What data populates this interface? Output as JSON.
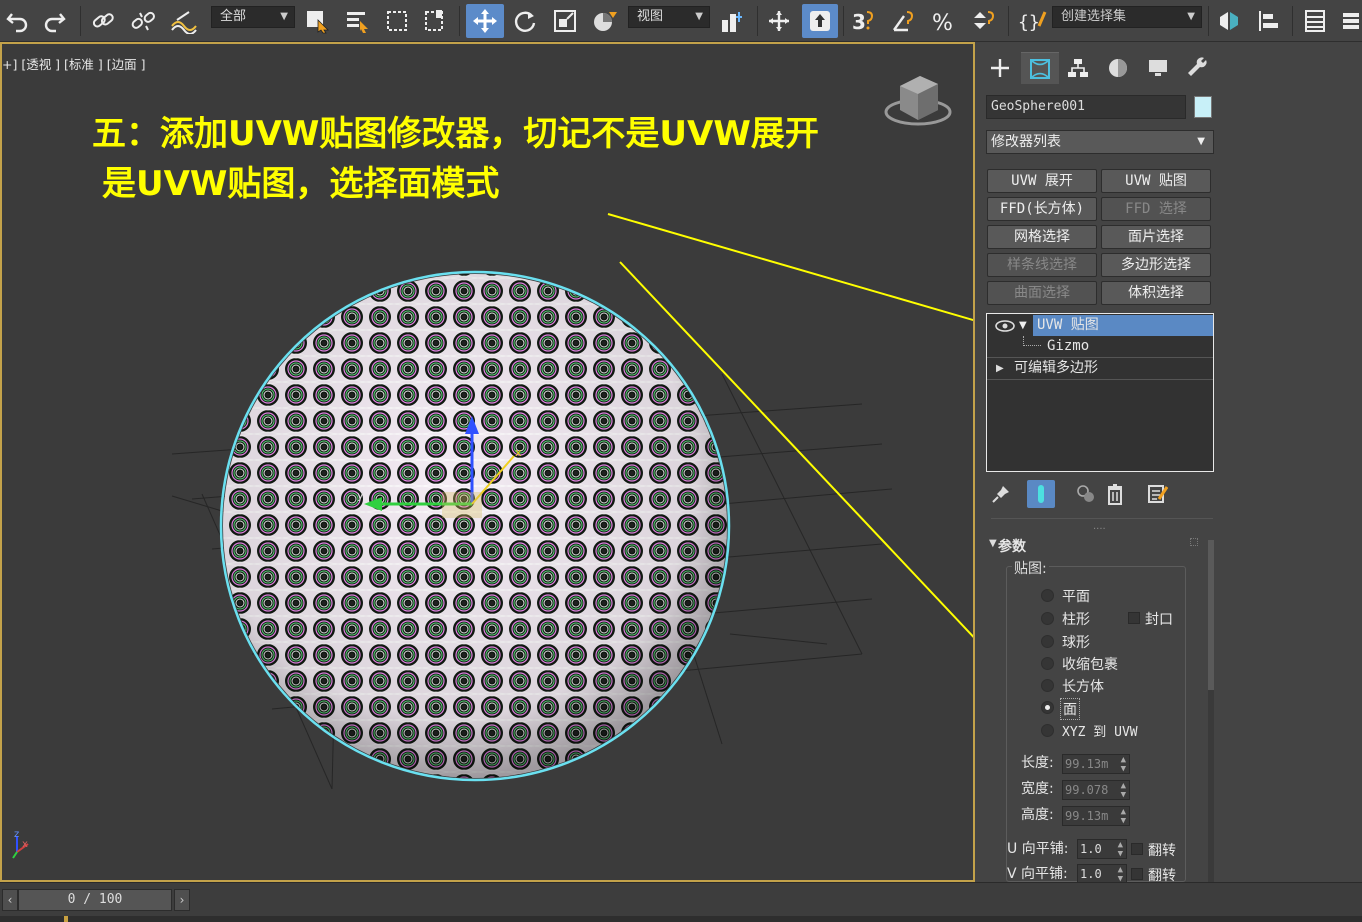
{
  "toolbar": {
    "selection_filter": "全部",
    "ref_coord": "视图",
    "named_selection_placeholder": "创建选择集"
  },
  "viewport": {
    "label": "+] [透视 ] [标准 ] [边面 ]",
    "annotation_line1": "五：添加UVW贴图修改器，切记不是UVW展开",
    "annotation_line2": "是UVW贴图，选择面模式",
    "gizmo_x": "x",
    "gizmo_y": "y",
    "axis_z": "z",
    "axis_x": "x",
    "annotation_color": "#ffff00"
  },
  "panel": {
    "object_name": "GeoSphere001",
    "object_color": "#c8f0f8",
    "modifier_list": "修改器列表",
    "modifier_buttons": [
      {
        "label": "UVW 展开",
        "enabled": true
      },
      {
        "label": "UVW 贴图",
        "enabled": true
      },
      {
        "label": "FFD(长方体)",
        "enabled": true
      },
      {
        "label": "FFD 选择",
        "enabled": false
      },
      {
        "label": "网格选择",
        "enabled": true
      },
      {
        "label": "面片选择",
        "enabled": true
      },
      {
        "label": "样条线选择",
        "enabled": false
      },
      {
        "label": "多边形选择",
        "enabled": true
      },
      {
        "label": "曲面选择",
        "enabled": false
      },
      {
        "label": "体积选择",
        "enabled": true
      }
    ],
    "stack": [
      {
        "label": "UVW 贴图",
        "selected": true
      },
      {
        "label": "Gizmo",
        "selected": false
      },
      {
        "label": "可编辑多边形",
        "selected": false
      }
    ],
    "rollout_title": "参数",
    "mapping_group": "贴图:",
    "mapping_options": [
      "平面",
      "柱形",
      "球形",
      "收缩包裹",
      "长方体",
      "面",
      "XYZ 到 UVW"
    ],
    "mapping_selected": "面",
    "cap_label": "封口",
    "length_label": "长度:",
    "length_value": "99.13m",
    "width_label": "宽度:",
    "width_value": "99.078",
    "height_label": "高度:",
    "height_value": "99.13m",
    "u_tile_label": "U 向平铺:",
    "u_tile_value": "1.0",
    "v_tile_label": "V 向平铺:",
    "v_tile_value": "1.0",
    "flip_label": "翻转",
    "accent": "#5a89c4"
  },
  "timeline": {
    "frame": "0 / 100"
  }
}
